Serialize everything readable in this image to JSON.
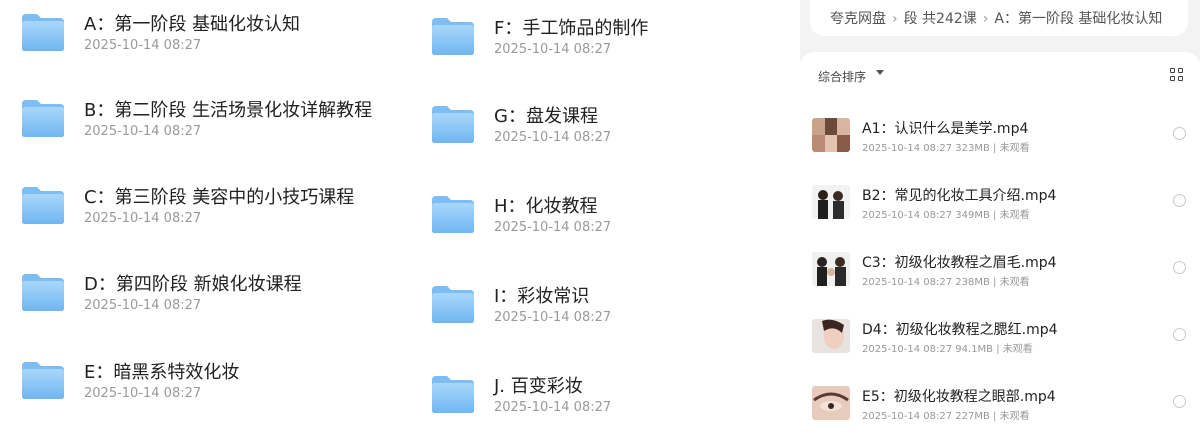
{
  "left_folders": [
    {
      "title": "A：第一阶段 基础化妆认知",
      "date": "2025-10-14 08:27"
    },
    {
      "title": "B：第二阶段 生活场景化妆详解教程",
      "date": "2025-10-14 08:27"
    },
    {
      "title": "C：第三阶段 美容中的小技巧课程",
      "date": "2025-10-14 08:27"
    },
    {
      "title": "D：第四阶段 新娘化妆课程",
      "date": "2025-10-14 08:27"
    },
    {
      "title": "E：暗黑系特效化妆",
      "date": "2025-10-14 08:27"
    }
  ],
  "mid_folders": [
    {
      "title": "F：手工饰品的制作",
      "date": "2025-10-14 08:27"
    },
    {
      "title": "G：盘发课程",
      "date": "2025-10-14 08:27"
    },
    {
      "title": "H：化妆教程",
      "date": "2025-10-14 08:27"
    },
    {
      "title": "I：彩妆常识",
      "date": "2025-10-14 08:27"
    },
    {
      "title": "J. 百变彩妆",
      "date": "2025-10-14 08:27"
    }
  ],
  "breadcrumb": {
    "root": "夸克网盘",
    "parent": "段 共242课",
    "current": "A：第一阶段 基础化妆认知"
  },
  "list_header": {
    "sort_label": "综合排序",
    "view_icon": "grid-view-icon"
  },
  "files": [
    {
      "title": "A1：认识什么是美学.mp4",
      "meta": "2025-10-14 08:27  323MB | 未观看"
    },
    {
      "title": "B2：常见的化妆工具介绍.mp4",
      "meta": "2025-10-14 08:27  349MB | 未观看"
    },
    {
      "title": "C3：初级化妆教程之眉毛.mp4",
      "meta": "2025-10-14 08:27  238MB | 未观看"
    },
    {
      "title": "D4：初级化妆教程之腮红.mp4",
      "meta": "2025-10-14 08:27  94.1MB | 未观看"
    },
    {
      "title": "E5：初级化妆教程之眼部.mp4",
      "meta": "2025-10-14 08:27  227MB | 未观看"
    }
  ],
  "colors": {
    "folder_light": "#8ec9f7",
    "folder_dark": "#5aa8ef",
    "accent_bg": "#f3f3f3"
  }
}
